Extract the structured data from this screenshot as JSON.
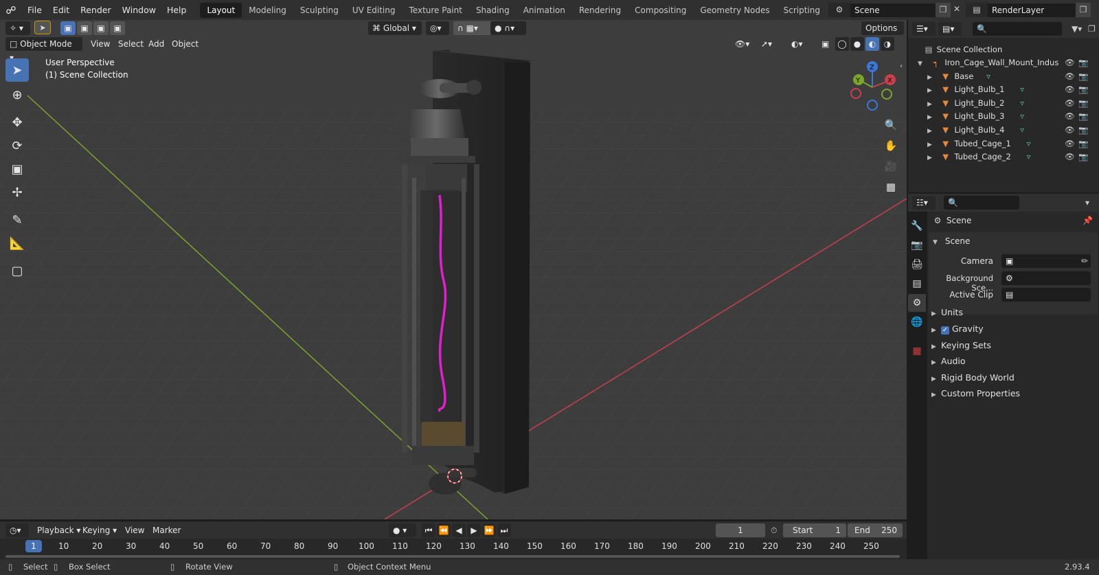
{
  "menu": {
    "items": [
      "File",
      "Edit",
      "Render",
      "Window",
      "Help"
    ]
  },
  "workspaces": [
    "Layout",
    "Modeling",
    "Sculpting",
    "UV Editing",
    "Texture Paint",
    "Shading",
    "Animation",
    "Rendering",
    "Compositing",
    "Geometry Nodes",
    "Scripting"
  ],
  "scene_selector": {
    "value": "Scene"
  },
  "viewlayer_selector": {
    "value": "RenderLayer"
  },
  "viewport": {
    "transform_orientation": "Global",
    "options_label": "Options",
    "mode": "Object Mode",
    "header_menus": [
      "View",
      "Select",
      "Add",
      "Object"
    ],
    "overlay_title": "User Perspective",
    "overlay_subtitle": "(1) Scene Collection",
    "gizmo": {
      "x": "X",
      "y": "Y",
      "z": "Z"
    }
  },
  "outliner": {
    "root": "Scene Collection",
    "collection": "Iron_Cage_Wall_Mount_Indus",
    "objects": [
      "Base",
      "Light_Bulb_1",
      "Light_Bulb_2",
      "Light_Bulb_3",
      "Light_Bulb_4",
      "Tubed_Cage_1",
      "Tubed_Cage_2"
    ]
  },
  "properties": {
    "context": "Scene",
    "panel_title": "Scene",
    "fields": [
      {
        "label": "Camera",
        "value": ""
      },
      {
        "label": "Background Sce...",
        "value": ""
      },
      {
        "label": "Active Clip",
        "value": ""
      }
    ],
    "sections": [
      "Units",
      "Gravity",
      "Keying Sets",
      "Audio",
      "Rigid Body World",
      "Custom Properties"
    ],
    "gravity_checked": true
  },
  "timeline": {
    "menus": [
      "Playback",
      "Keying",
      "View",
      "Marker"
    ],
    "current_frame": "1",
    "start_label": "Start",
    "start": "1",
    "end_label": "End",
    "end": "250",
    "ruler": [
      "1",
      "10",
      "20",
      "30",
      "40",
      "50",
      "60",
      "70",
      "80",
      "90",
      "100",
      "110",
      "120",
      "130",
      "140",
      "150",
      "160",
      "170",
      "180",
      "190",
      "200",
      "210",
      "220",
      "230",
      "240",
      "250"
    ]
  },
  "status": {
    "select": "Select",
    "box_select": "Box Select",
    "rotate": "Rotate View",
    "context_menu": "Object Context Menu",
    "version": "2.93.4"
  },
  "colors": {
    "accent": "#4772b3",
    "object_orange": "#e5883a",
    "mesh_green": "#5ec9a0",
    "filament": "#e020d0",
    "x_axis": "#c8404c",
    "y_axis": "#7ca52c",
    "z_axis": "#3c78d8"
  }
}
